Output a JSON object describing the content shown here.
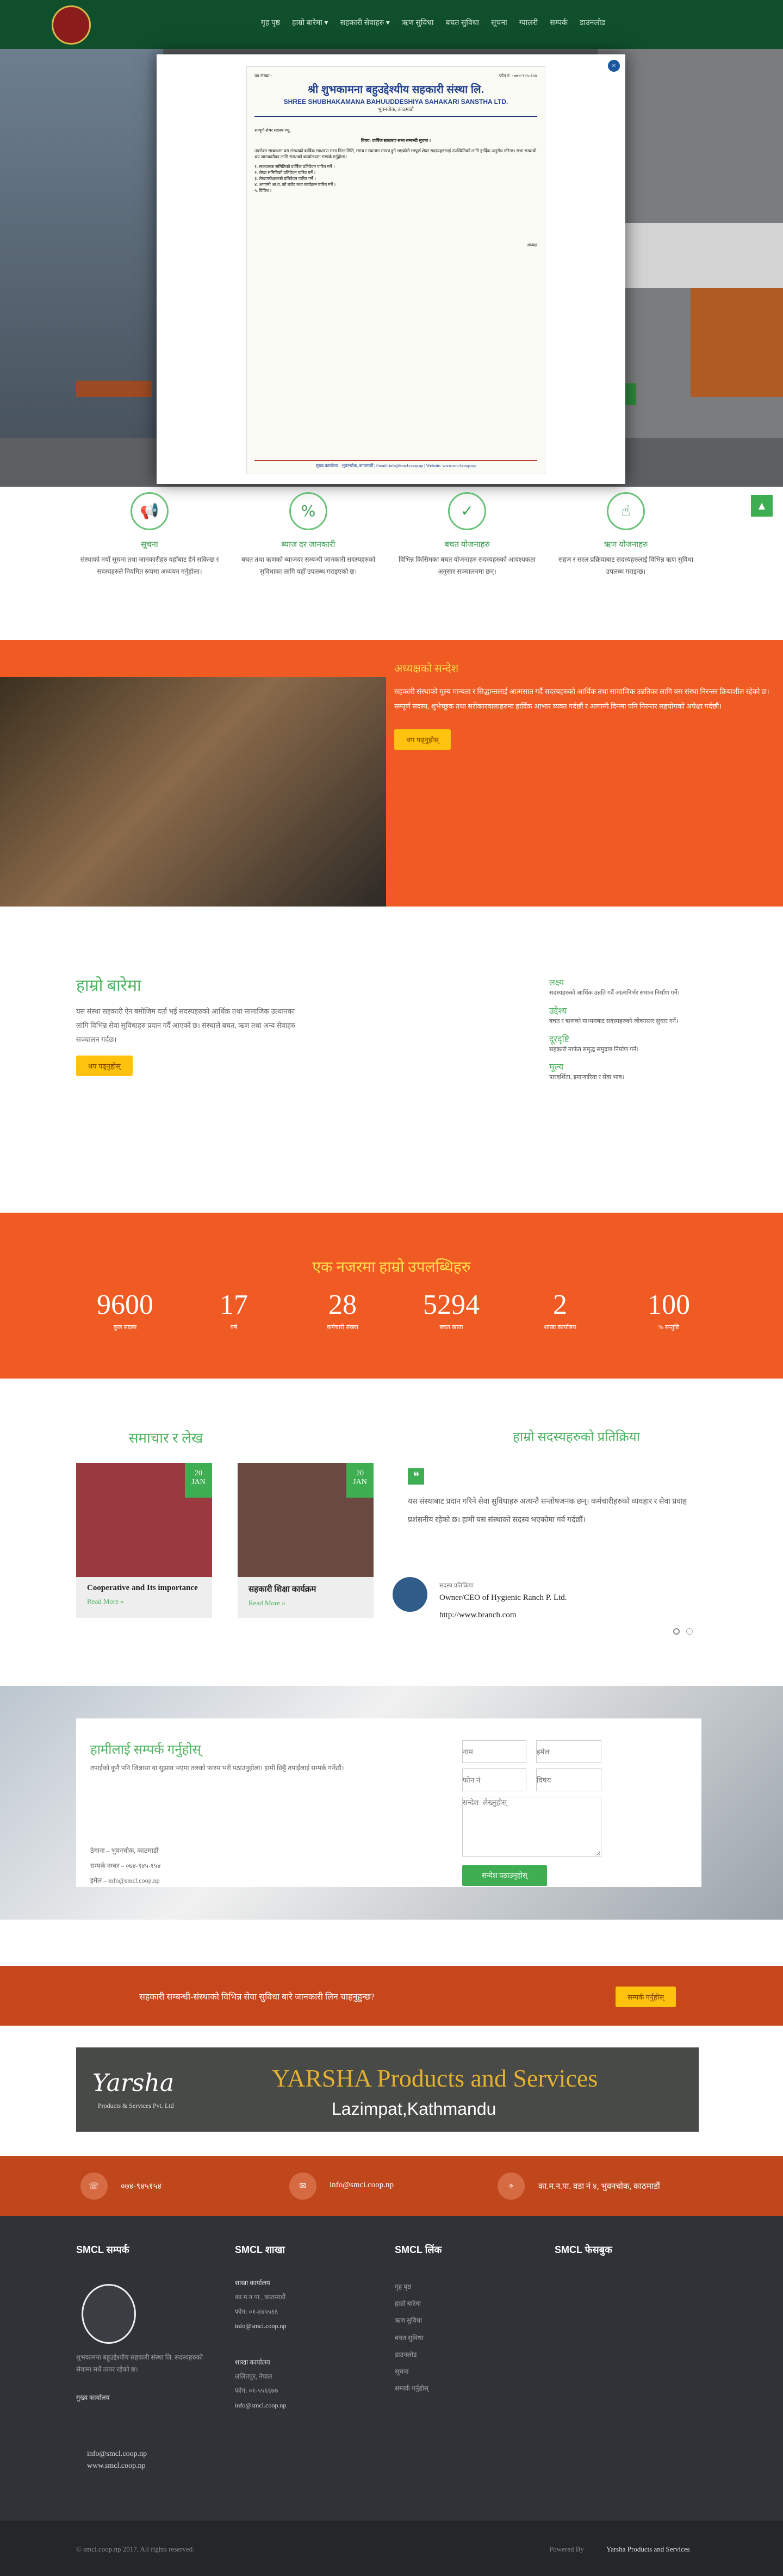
{
  "nav": {
    "items": [
      "गृह पृष्ठ",
      "हाम्रो बारेमा ▾",
      "सहकारी सेवाहरु ▾",
      "ऋण सुविधा",
      "बचत सुविधा",
      "सूचना",
      "ग्यालरी",
      "सम्पर्क",
      "डाउनलोड"
    ]
  },
  "letter": {
    "ref_left": "पत्र संख्या :",
    "ref_right": "फोन नं. : ०७४-९४५-१५४",
    "title_np": "श्री शुभकामना बहुउद्देश्यीय सहकारी संस्था लि.",
    "title_en": "SHREE SHUBHAKAMANA BAHUUDDESHIYA SAHAKARI SANSTHA LTD.",
    "address": "भुवनचोक, काठमाडौं",
    "salutation": "सम्पूर्ण शेयर सदस्य ज्यू,",
    "subject": "विषय: वार्षिक साधारण सभा सम्बन्धी सूचना ।",
    "body": "उपरोक्त सम्बन्धमा यस संस्थाको वार्षिक साधारण सभा निम्न मिति, समय र स्थानमा सम्पन्न हुने भएकोले सम्पूर्ण शेयर सदस्यहरुलाई उपस्थितिको लागि हार्दिक अनुरोध गरिन्छ। सभा सम्बन्धी थप जानकारीका लागि संस्थाको कार्यालयमा सम्पर्क गर्नुहोला।",
    "agenda": [
      "१. सञ्चालक समितिको वार्षिक प्रतिवेदन पारित गर्ने ।",
      "२. लेखा समितिको प्रतिवेदन पारित गर्ने ।",
      "३. लेखापरीक्षकको प्रतिवेदन पारित गर्ने ।",
      "४. आगामी आ.व. को बजेट तथा कार्यक्रम पारित गर्ने ।",
      "५. विविध ।"
    ],
    "signature": "अध्यक्ष",
    "footer": "मुख्य कार्यालय : भुवनचोक, काठमाडौं | Email: info@smcl.coop.np | Website: www.smcl.coop.np"
  },
  "services": [
    {
      "icon": "megaphone-icon",
      "glyph": "📢",
      "title": "सूचना",
      "text": "संस्थाको नयाँ सूचना तथा जानकारीहरु यहाँबाट हेर्न सकिन्छ र सदस्यहरुले नियमित रूपमा अध्ययन गर्नुहोला।"
    },
    {
      "icon": "percent-icon",
      "glyph": "%",
      "title": "ब्याज दर जानकारी",
      "text": "बचत तथा ऋणको ब्याजदर सम्बन्धी जानकारी सदस्यहरुको सुविधाका लागि यहाँ उपलब्ध गराइएको छ।"
    },
    {
      "icon": "check-icon",
      "glyph": "✓",
      "title": "बचत योजनाहरु",
      "text": "विभिन्न किसिमका बचत योजनाहरु सदस्यहरुको आवश्यकता अनुसार सञ्चालनमा छन्।"
    },
    {
      "icon": "pointer-icon",
      "glyph": "☝",
      "title": "ऋण योजनाहरु",
      "text": "सहज र सरल प्रक्रियाबाट सदस्यहरुलाई विभिन्न ऋण सुविधा उपलब्ध गराइन्छ।"
    }
  ],
  "message": {
    "title": "अध्यक्षको सन्देश",
    "body": "सहकारी संस्थाको मूल्य मान्यता र सिद्धान्तलाई आत्मसात गर्दै सदस्यहरुको आर्थिक तथा सामाजिक उन्नतिका लागि यस संस्था निरन्तर क्रियाशील रहेको छ। सम्पूर्ण सदस्य, शुभेच्छुक तथा सरोकारवालाहरुमा हार्दिक आभार व्यक्त गर्दछौं र आगामी दिनमा पनि निरन्तर सहयोगको अपेक्षा गर्दछौं।",
    "button": "थप पढ्नुहोस्"
  },
  "about": {
    "title": "हाम्रो बारेमा",
    "body": "यस संस्था सहकारी ऐन बमोजिम दर्ता भई सदस्यहरुको आर्थिक तथा सामाजिक उत्थानका लागि विभिन्न सेवा सुविधाहरु प्रदान गर्दै आएको छ। संस्थाले बचत, ऋण तथा अन्य सेवाहरु सञ्चालन गर्दछ।",
    "button": "थप पढ्नुहोस्",
    "side": [
      {
        "h": "लक्ष्य",
        "t": "सदस्यहरुको आर्थिक उन्नति गर्दै आत्मनिर्भर समाज निर्माण गर्ने।"
      },
      {
        "h": "उद्देश्य",
        "t": "बचत र ऋणको माध्यमबाट सदस्यहरुको जीवनस्तर सुधार गर्ने।"
      },
      {
        "h": "दूरदृष्टि",
        "t": "सहकारी मार्फत समृद्ध समुदाय निर्माण गर्ने।"
      },
      {
        "h": "मूल्य",
        "t": "पारदर्शिता, इमान्दारिता र सेवा भाव।"
      }
    ]
  },
  "stats": {
    "title": "एक नजरमा हाम्रो उपलब्धिहरु",
    "items": [
      {
        "n": "9600",
        "l": "कुल सदस्य"
      },
      {
        "n": "17",
        "l": "वर्ष"
      },
      {
        "n": "28",
        "l": "कर्मचारी संख्या"
      },
      {
        "n": "5294",
        "l": "बचत खाता"
      },
      {
        "n": "2",
        "l": "शाखा कार्यालय"
      },
      {
        "n": "100",
        "l": "% सन्तुष्टि"
      }
    ]
  },
  "news": {
    "title": "समाचार र लेख",
    "items": [
      {
        "day": "20",
        "mon": "JAN",
        "title": "Cooperative and Its importance",
        "more": "Read More »"
      },
      {
        "day": "20",
        "mon": "JAN",
        "title": "सहकारी शिक्षा कार्यक्रम",
        "more": "Read More »"
      }
    ]
  },
  "testimonial": {
    "title": "हाम्रो सदस्यहरुको प्रतिक्रिया",
    "quote": "यस संस्थाबाट प्रदान गरिने सेवा सुविधाहरु अत्यन्तै सन्तोषजनक छन्। कर्मचारीहरुको व्यवहार र सेवा प्रवाह प्रशंसनीय रहेको छ। हामी यस संस्थाको सदस्य भएकोमा गर्व गर्दछौं।",
    "name": "सदस्य प्रतिक्रिया",
    "role": "Owner/CEO of Hygienic Ranch P. Ltd.",
    "url": "http://www.branch.com"
  },
  "contactForm": {
    "title": "हामीलाई सम्पर्क गर्नुहोस्",
    "body": "तपाईंको कुनै पनि जिज्ञासा वा सुझाव भएमा तलको फारम भरी पठाउनुहोला। हामी छिट्टै तपाईंलाई सम्पर्क गर्नेछौं।",
    "lines": [
      "ठेगाना – भुवनचोक, काठमाडौं",
      "सम्पर्क नम्बर – ०७४-९४५-१५४",
      "इमेल – info@smcl.coop.np"
    ],
    "ph_name": "नाम",
    "ph_email": "इमेल",
    "ph_phone": "फोन नं",
    "ph_subject": "विषय",
    "ph_msg": "सन्देश लेख्नुहोस्",
    "submit": "सन्देश पठाउनुहोस्"
  },
  "cta": {
    "text": "सहकारी सम्बन्धी-संस्थाको विभिन्न सेवा सुविधा बारे जानकारी लिन चाहनुहुन्छ?",
    "button": "सम्पर्क गर्नुहोस्"
  },
  "ad": {
    "brand": "Yarsha",
    "tag": "Products & Services Pvt. Ltd",
    "title": "YARSHA Products and Services",
    "sub": "Lazimpat,Kathmandu"
  },
  "contact": {
    "phone": "०७४-९४५१५४",
    "email": "info@smcl.coop.np",
    "address": "का.म.न.पा. वडा नं ४, भुवनचोक, काठमाडौं"
  },
  "footer": {
    "col1": "SMCL सम्पर्क",
    "col2": "SMCL शाखा",
    "col3": "SMCL लिंक",
    "col4": "SMCL फेसबुक",
    "about": "शुभकामना बहुउद्देश्यीय सहकारी संस्था लि. सदस्यहरुको सेवामा सधैं तत्पर रहेको छ।",
    "office": "मुख्य कार्यालय",
    "email": "info@smcl.coop.np",
    "web": "www.smcl.coop.np",
    "branches": [
      {
        "h": "शाखा कार्यालय",
        "a": "का.म.न.पा., काठमाडौं",
        "p": "फोन: ०१-४४५५६६",
        "e": "info@smcl.coop.np"
      },
      {
        "h": "शाखा कार्यालय",
        "a": "ललितपुर, नेपाल",
        "p": "फोन: ०१-५५६६७७",
        "e": "info@smcl.coop.np"
      }
    ],
    "links": [
      "गृह पृष्ठ",
      "हाम्रो बारेमा",
      "ऋण सुविधा",
      "बचत सुविधा",
      "डाउनलोड",
      "सूचना",
      "सम्पर्क गर्नुहोस्"
    ]
  },
  "bottom": {
    "copy": "© smcl.coop.np 2017, All rights reserved.",
    "powered": "Powered By",
    "powered_by": "Yarsha Products and Services"
  }
}
